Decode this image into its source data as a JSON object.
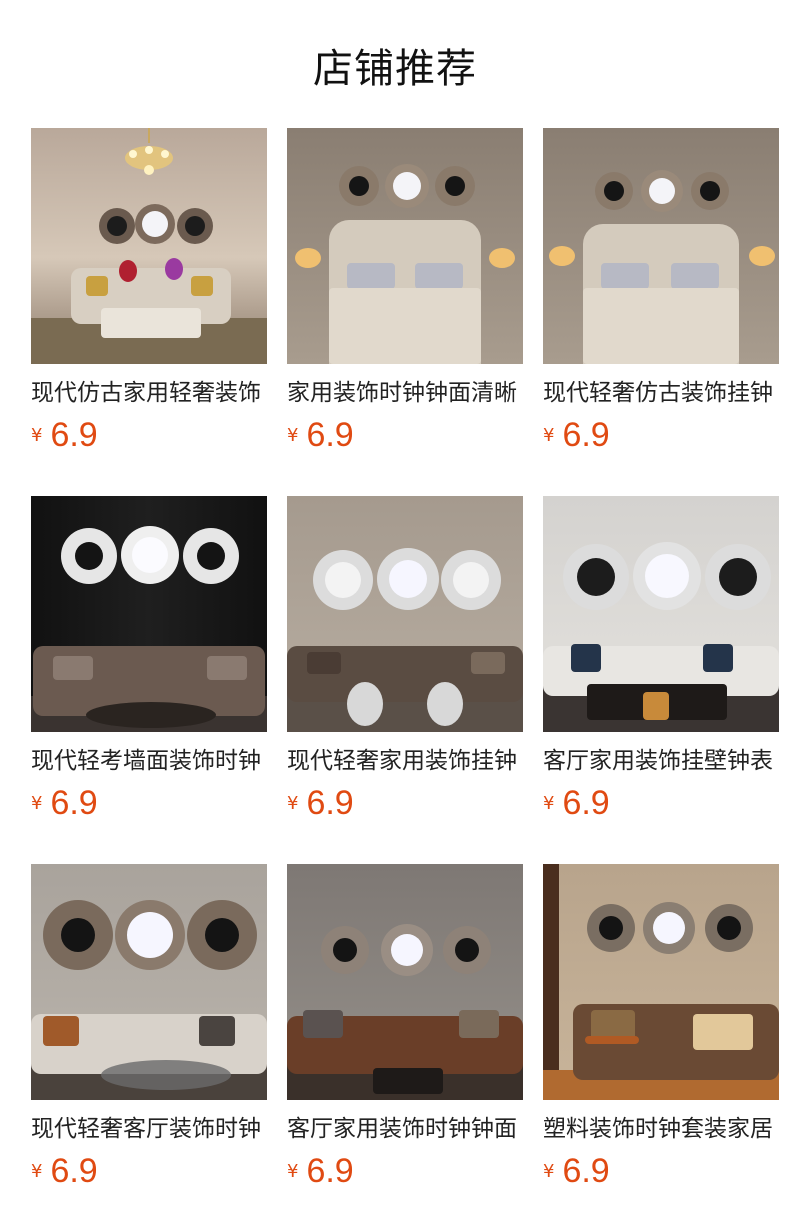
{
  "section": {
    "title": "店铺推荐"
  },
  "colors": {
    "price": "#e04a12",
    "title": "#111111"
  },
  "products": [
    {
      "name": "现代仿古家用轻奢装饰",
      "currency": "¥",
      "price": "6.9",
      "scene": "classic-livingroom"
    },
    {
      "name": "家用装饰时钟钟面清晰",
      "currency": "¥",
      "price": "6.9",
      "scene": "bedroom"
    },
    {
      "name": "现代轻奢仿古装饰挂钟",
      "currency": "¥",
      "price": "6.9",
      "scene": "bedroom"
    },
    {
      "name": "现代轻考墙面装饰时钟",
      "currency": "¥",
      "price": "6.9",
      "scene": "dark-livingroom"
    },
    {
      "name": "现代轻奢家用装饰挂钟",
      "currency": "¥",
      "price": "6.9",
      "scene": "mirror-livingroom"
    },
    {
      "name": "客厅家用装饰挂壁钟表",
      "currency": "¥",
      "price": "6.9",
      "scene": "white-livingroom"
    },
    {
      "name": "现代轻奢客厅装饰时钟",
      "currency": "¥",
      "price": "6.9",
      "scene": "grey-livingroom"
    },
    {
      "name": "客厅家用装饰时钟钟面",
      "currency": "¥",
      "price": "6.9",
      "scene": "dark-sofa"
    },
    {
      "name": "塑料装饰时钟套装家居",
      "currency": "¥",
      "price": "6.9",
      "scene": "floral-sofa"
    }
  ]
}
